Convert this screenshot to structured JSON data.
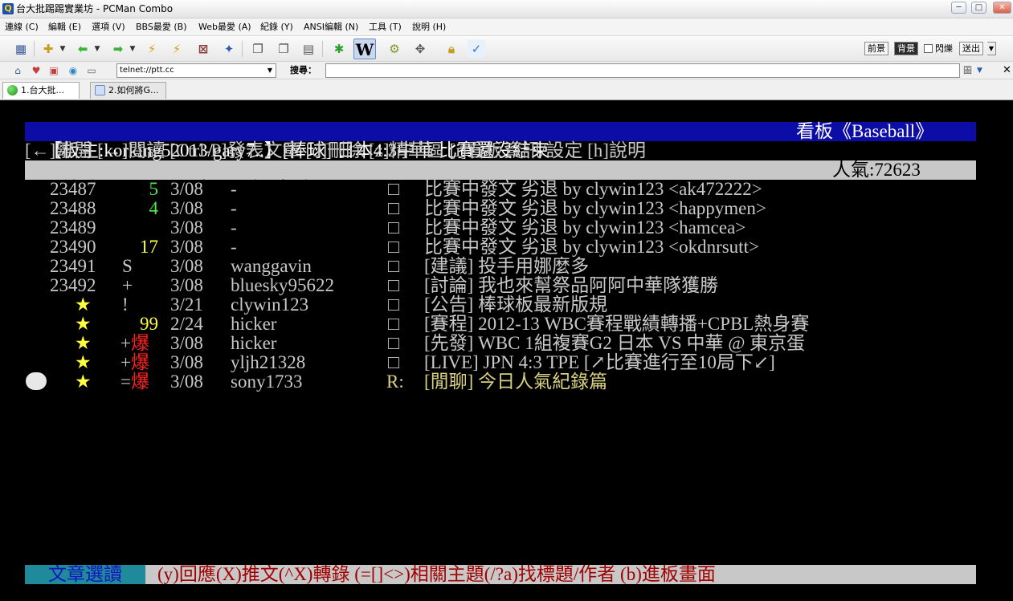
{
  "window": {
    "title": "台大批踢踢實業坊 - PCMan Combo",
    "buttons": {
      "minimize": "─",
      "maximize": "□",
      "close": "✕"
    }
  },
  "menu": [
    "連線 (C)",
    "編輯 (E)",
    "選項 (V)",
    "BBS最愛 (B)",
    "Web最愛 (A)",
    "紀錄 (Y)",
    "ANSI編輯 (N)",
    "工具 (T)",
    "說明 (H)"
  ],
  "toolbar": {
    "right_buttons": {
      "foreground": "前景",
      "background": "背景",
      "flash": "閃爍",
      "send": "送出"
    }
  },
  "address_bar": {
    "address": "telnet://ptt.cc",
    "search_label": "搜尋：",
    "search_value": "",
    "search_engine": "圖"
  },
  "tabs": [
    {
      "label": "1.台大批..."
    },
    {
      "label": "2.如何將G..."
    }
  ],
  "terminal": {
    "header_left": "【板主:korking52013/gary7..】[棒球] 日本4:3中華 比賽還沒結束",
    "header_board": "看板《Baseball》",
    "help": "[←]離開 [→]閱讀 [Ctrl-P]發表文章 [d]刪除 [z]精華區 [i]看板資訊/設定 [h]說明",
    "columns": "    編號     日 期 作  者       文  章  標  題",
    "popularity": "人氣:72623",
    "rows": [
      {
        "num": "23487",
        "mark": "5",
        "date": "3/08",
        "author": "-",
        "flag": "□",
        "title": "比賽中發文 劣退 by clywin123 <ak472222>"
      },
      {
        "num": "23488",
        "mark": "4",
        "date": "3/08",
        "author": "-",
        "flag": "□",
        "title": "比賽中發文 劣退 by clywin123 <happymen>"
      },
      {
        "num": "23489",
        "mark": "",
        "date": "3/08",
        "author": "-",
        "flag": "□",
        "title": "比賽中發文 劣退 by clywin123 <hamcea>"
      },
      {
        "num": "23490",
        "mark": "17",
        "date": "3/08",
        "author": "-",
        "flag": "□",
        "title": "比賽中發文 劣退 by clywin123 <okdnrsutt>"
      },
      {
        "num": "23491",
        "mark": "S",
        "date": "3/08",
        "author": "wanggavin",
        "flag": "□",
        "title": "[建議] 投手用娜麼多"
      },
      {
        "num": "23492",
        "mark": "+",
        "date": "3/08",
        "author": "bluesky95622",
        "flag": "□",
        "title": "[討論] 我也來幫祭品阿阿中華隊獲勝"
      },
      {
        "num": "★",
        "mark": "!",
        "date": "3/21",
        "author": "clywin123",
        "flag": "□",
        "title": "[公告] 棒球板最新版規"
      },
      {
        "num": "★",
        "mark": "99",
        "date": "2/24",
        "author": "hicker",
        "flag": "□",
        "title": "[賽程] 2012-13 WBC賽程戰績轉播+CPBL熱身賽"
      },
      {
        "num": "★",
        "mark": "+爆",
        "date": "3/08",
        "author": "hicker",
        "flag": "□",
        "title": "[先發] WBC 1組複賽G2 日本 VS 中華 @ 東京蛋"
      },
      {
        "num": "★",
        "mark": "+爆",
        "date": "3/08",
        "author": "yljh21328",
        "flag": "□",
        "title": "[LIVE] JPN 4:3 TPE [↗比賽進行至10局下↙]"
      },
      {
        "num": "★",
        "mark": "=爆",
        "date": "3/08",
        "author": "sony1733",
        "flag": "R:",
        "title": "[閒聊] 今日人氣紀錄篇"
      }
    ],
    "status_mode": "文章選讀",
    "status_help": "(y)回應(X)推文(^X)轉錄 (=[]<>)相關主題(/?a)找標題/作者 (b)進板畫面"
  },
  "colors": {
    "header_bg": "#0c0ca6",
    "bar_bg": "#c8c8c8",
    "status_mode_bg": "#1e8a9a",
    "star": "#ffff3c",
    "explode": "#ff2020"
  }
}
